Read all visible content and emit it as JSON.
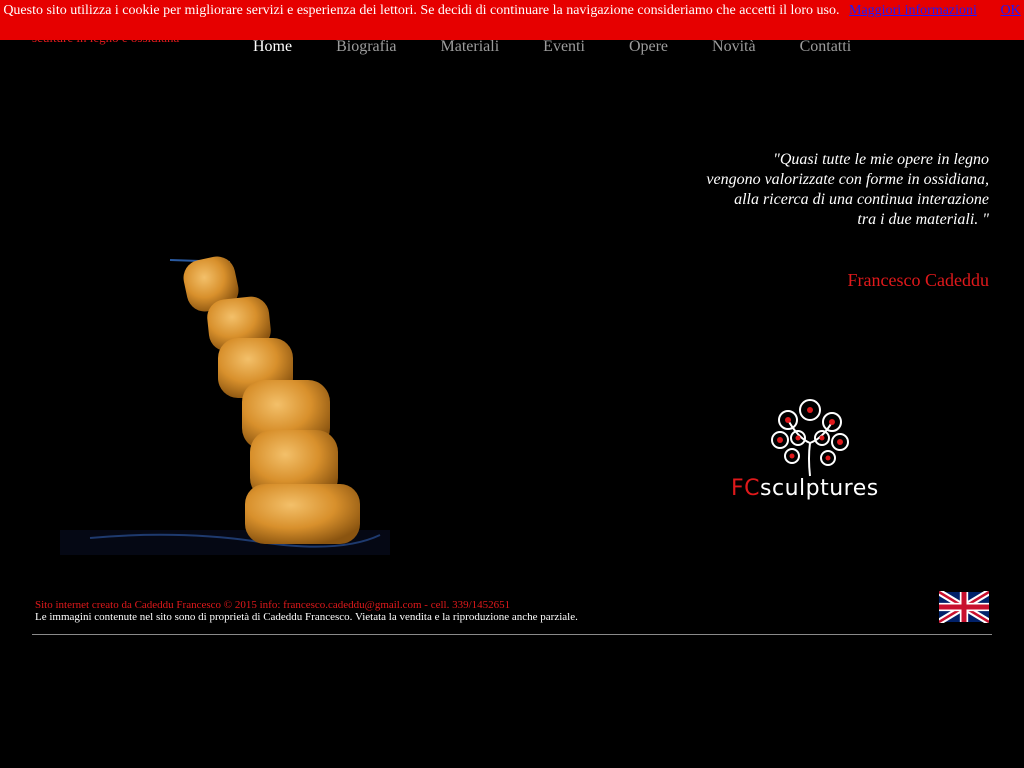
{
  "header": {
    "tagline": "sculture in legno e ossidiana"
  },
  "nav": {
    "items": [
      {
        "label": "Home"
      },
      {
        "label": "Biografia"
      },
      {
        "label": "Materiali"
      },
      {
        "label": "Eventi"
      },
      {
        "label": "Opere"
      },
      {
        "label": "Novità"
      },
      {
        "label": "Contatti"
      }
    ]
  },
  "cookie_bar": {
    "text": "Questo sito utilizza i cookie per migliorare servizi e esperienza dei lettori. Se decidi di continuare la navigazione consideriamo che accetti il loro uso.",
    "more_info": "Maggiori informazioni",
    "ok": "OK"
  },
  "quote": {
    "line1": "\"Quasi tutte le mie opere in legno",
    "line2": "vengono valorizzate con forme in ossidiana,",
    "line3": "alla ricerca di una continua interazione",
    "line4": "tra i due materiali. \"",
    "author": "Francesco Cadeddu"
  },
  "logo": {
    "fc": "FC",
    "rest": "sculptures"
  },
  "footer": {
    "credits": "Sito internet creato da Cadeddu Francesco © 2015 info: francesco.cadeddu@gmail.com - cell. 339/1452651",
    "rights": "Le immagini contenute nel sito sono di proprietà di Cadeddu Francesco. Vietata la vendita e la riproduzione anche parziale."
  },
  "colors": {
    "accent_red": "#e0191b",
    "cookie_bg": "#e60000",
    "nav_inactive": "#9c9c9c",
    "link_blue": "#1a1aff"
  },
  "icons": {
    "language_flag": "uk-flag-icon",
    "logo_tree": "tree-logo-icon"
  }
}
